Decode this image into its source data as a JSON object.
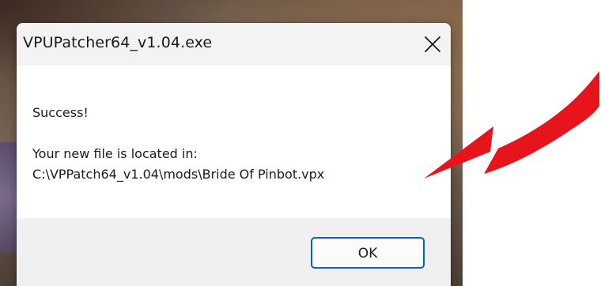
{
  "dialog": {
    "title": "VPUPatcher64_v1.04.exe",
    "close_icon": "close-icon",
    "message": {
      "line1": "Success!",
      "line2": "Your new file is located in:",
      "line3": "C:\\VPPatch64_v1.04\\mods\\Bride Of Pinbot.vpx"
    },
    "ok_label": "OK"
  },
  "annotation": {
    "icon": "red-arrow-icon",
    "color": "#e8141b"
  },
  "colors": {
    "accent": "#0067c0",
    "titlebar": "#f3f3f3",
    "footer": "#f0f0f0"
  }
}
